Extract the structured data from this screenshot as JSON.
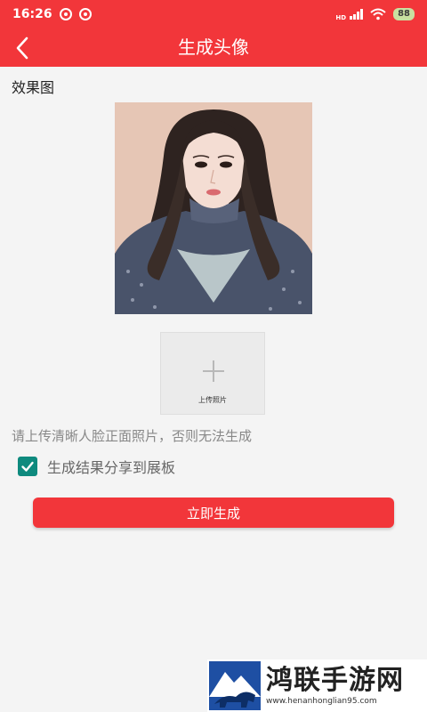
{
  "status": {
    "time": "16:26",
    "hd": "HD",
    "battery": "88"
  },
  "header": {
    "title": "生成头像"
  },
  "main": {
    "section_label": "效果图",
    "upload_label": "上传照片",
    "hint": "请上传清晰人脸正面照片，否则无法生成",
    "share_checkbox": {
      "label": "生成结果分享到展板",
      "checked": true
    },
    "generate_button": "立即生成"
  },
  "watermark": {
    "title": "鸿联手游网",
    "url": "www.henanhonglian95.com"
  },
  "colors": {
    "primary": "#f2363a",
    "checkbox": "#0e8a7e",
    "hint_text": "#888888"
  }
}
